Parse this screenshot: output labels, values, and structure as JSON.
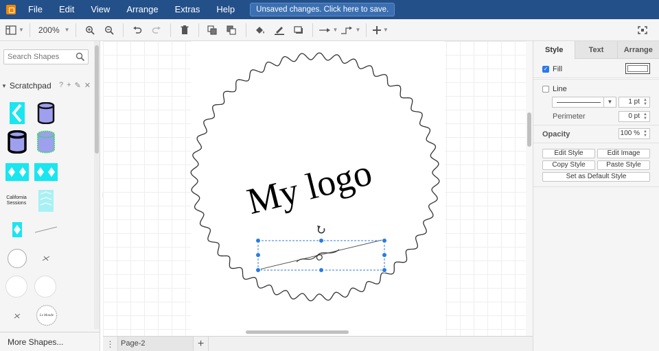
{
  "menubar": {
    "items": [
      "File",
      "Edit",
      "View",
      "Arrange",
      "Extras",
      "Help"
    ],
    "save_banner": "Unsaved changes. Click here to save."
  },
  "toolbar": {
    "zoom": "200%"
  },
  "sidebar": {
    "search_placeholder": "Search Shapes",
    "scratchpad_label": "Scratchpad",
    "scratchpad_help": "?",
    "california_label_line1": "California",
    "california_label_line2": "Sessions",
    "le_monde_label": "Le Monde",
    "more_shapes": "More Shapes..."
  },
  "canvas": {
    "logo_text": "My logo"
  },
  "pagebar": {
    "page_name": "Page-2"
  },
  "format_panel": {
    "tabs": [
      "Style",
      "Text",
      "Arrange"
    ],
    "fill_label": "Fill",
    "fill_checked": true,
    "line_label": "Line",
    "line_checked": false,
    "line_width": "1 pt",
    "perimeter_label": "Perimeter",
    "perimeter_value": "0 pt",
    "opacity_label": "Opacity",
    "opacity_value": "100 %",
    "buttons": {
      "edit_style": "Edit Style",
      "edit_image": "Edit Image",
      "copy_style": "Copy Style",
      "paste_style": "Paste Style",
      "set_default": "Set as Default Style"
    }
  },
  "colors": {
    "menubar": "#24508a",
    "selection": "#2a7be4",
    "accent_cyan": "#19e6f0",
    "cylinder_fill": "#9f9ff0"
  }
}
